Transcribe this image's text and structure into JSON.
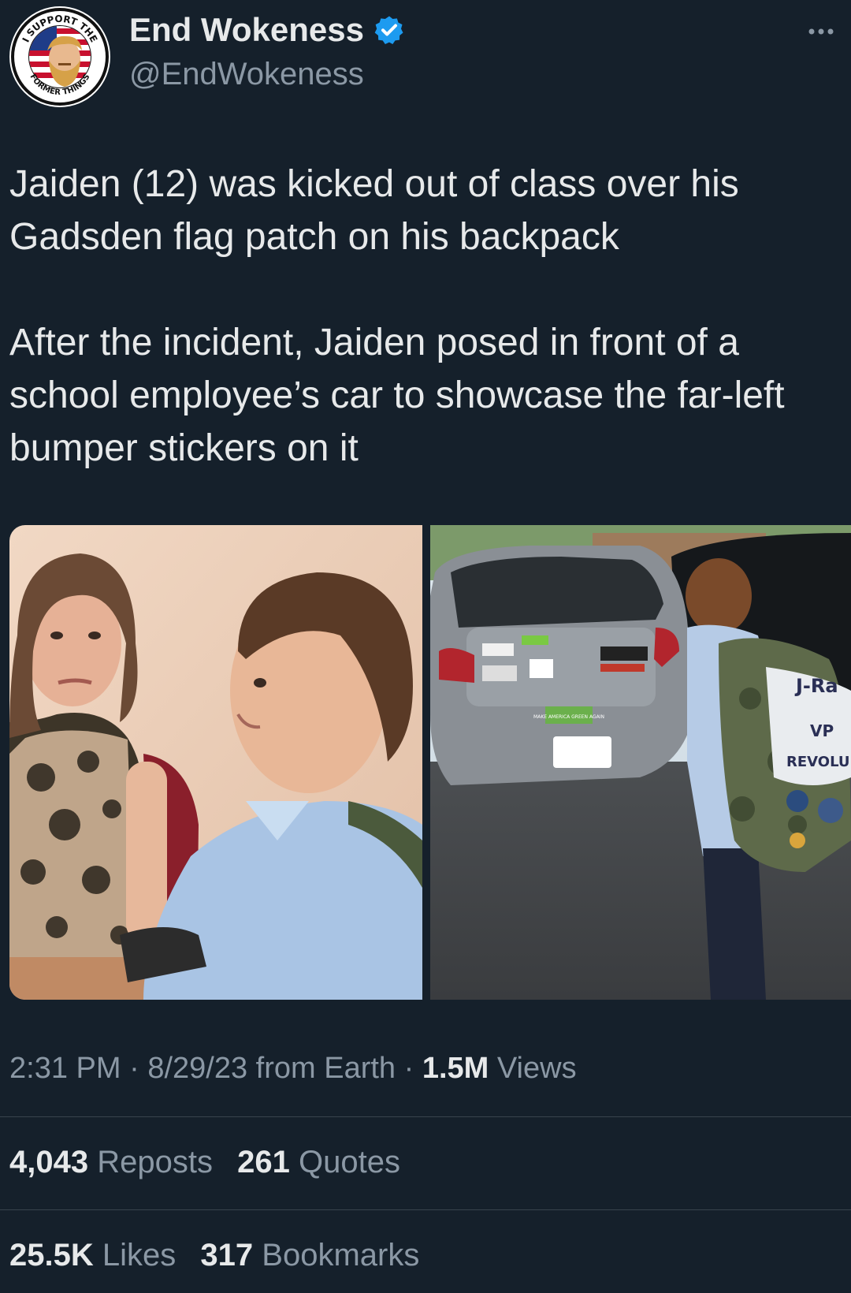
{
  "author": {
    "name": "End Wokeness",
    "handle": "@EndWokeness",
    "verified": true,
    "badge_color": "#1d9bf0",
    "avatar_text_top": "I SUPPORT THE",
    "avatar_text_bottom": "FORMER THINGS"
  },
  "tweet": {
    "paragraphs": [
      "Jaiden (12) was kicked out of class over his Gadsden flag patch on his backpack",
      "After the incident, Jaiden posed in front of a school employee’s car to showcase the far-left bumper stickers on it"
    ]
  },
  "media": {
    "photos": [
      {
        "name": "classroom-photo"
      },
      {
        "name": "car-photo",
        "sticker_text": "MAKE AMERICA GREEN AGAIN",
        "backpack_text_1": "J-Ra",
        "backpack_text_2": "VP",
        "backpack_text_3": "REVOLU"
      }
    ]
  },
  "meta": {
    "time": "2:31 PM",
    "sep1": "·",
    "date": "8/29/23",
    "source": "from Earth",
    "sep2": "·",
    "views_count": "1.5M",
    "views_label": "Views"
  },
  "engagement": {
    "reposts_count": "4,043",
    "reposts_label": "Reposts",
    "quotes_count": "261",
    "quotes_label": "Quotes",
    "likes_count": "25.5K",
    "likes_label": "Likes",
    "bookmarks_count": "317",
    "bookmarks_label": "Bookmarks"
  },
  "colors": {
    "background": "#15202b",
    "text_primary": "#e7e9ea",
    "text_secondary": "#8b98a5",
    "divider": "#38444d",
    "verified_blue": "#1d9bf0"
  },
  "icons": {
    "verified": "verified-badge-icon",
    "more": "more-options-icon"
  }
}
